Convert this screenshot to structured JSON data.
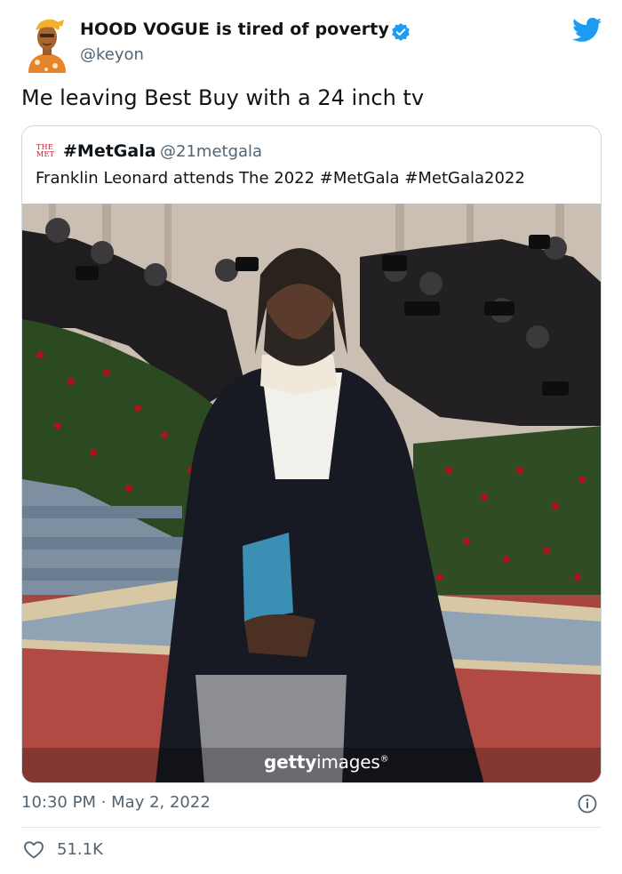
{
  "author": {
    "display_name": "HOOD VOGUE is tired of poverty",
    "handle": "@keyon",
    "verified": true,
    "avatar_icon": "cartoon-avatar-icon"
  },
  "tweet_text": "Me leaving Best Buy with a 24 inch tv",
  "quote": {
    "logo_text": "THE MET",
    "display_name": "#MetGala",
    "handle": "@21metgala",
    "text": "Franklin Leonard attends The 2022 #MetGala #MetGala2022",
    "image_watermark": {
      "bold": "getty",
      "regular": "images",
      "mark": "®"
    }
  },
  "meta": {
    "timestamp": "10:30 PM · May 2, 2022",
    "likes": "51.1K"
  },
  "colors": {
    "twitter_blue": "#1d9bf0",
    "text": "#0f1419",
    "secondary": "#536471",
    "border": "#cfd9de",
    "met_red": "#c8102e"
  }
}
